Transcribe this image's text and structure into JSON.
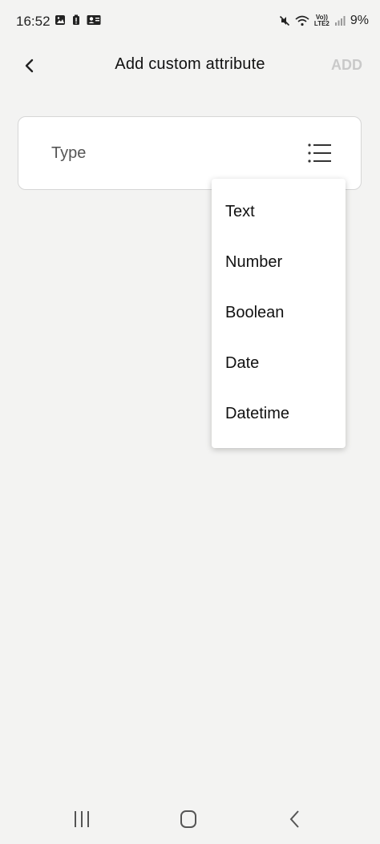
{
  "status_bar": {
    "time": "16:52",
    "battery": "9%",
    "network_badge_top": "Vo))",
    "network_badge_bottom": "LTE2"
  },
  "app_bar": {
    "title": "Add custom attribute",
    "action_label": "ADD"
  },
  "field": {
    "label": "Type"
  },
  "menu": {
    "items": [
      {
        "label": "Text"
      },
      {
        "label": "Number"
      },
      {
        "label": "Boolean"
      },
      {
        "label": "Date"
      },
      {
        "label": "Datetime"
      }
    ]
  },
  "colors": {
    "background": "#f3f3f2",
    "surface": "#ffffff",
    "disabled_action": "#c9c9c9",
    "text_primary": "#111111"
  },
  "icons": [
    "gallery-icon",
    "battery-alert-icon",
    "account-box-icon",
    "mute-icon",
    "wifi-icon",
    "signal-icon",
    "back-icon",
    "list-icon",
    "recent-apps-icon",
    "home-icon",
    "nav-back-icon"
  ]
}
